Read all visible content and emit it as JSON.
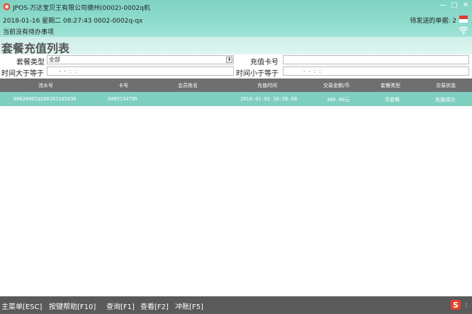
{
  "window": {
    "title": "JPOS-万达宝贝王有限公司德州(0002)-0002q机",
    "controls": [
      "—",
      "□",
      "✕"
    ]
  },
  "status": {
    "info": "2018-01-16 星期二 08:27:43 0002-0002q-qx",
    "pending_label": "待发送的单据: 2",
    "notice": "当前没有待办事项"
  },
  "page": {
    "title": "套餐充值列表"
  },
  "filters": {
    "package_type_label": "套餐类型",
    "package_type_value": "全部",
    "card_no_label": "充值卡号",
    "card_no_value": "",
    "time_from_label": "时间大于等于",
    "time_from_value": "- -    : :",
    "time_to_label": "时间小于等于",
    "time_to_value": "- -    : :"
  },
  "table": {
    "columns": [
      "流水号",
      "卡号",
      "会员姓名",
      "充值时间",
      "交易金额/币",
      "套餐类型",
      "交易状态"
    ],
    "rows": [
      {
        "serial": "00020002q180102165636",
        "card": "A005154795",
        "member": "",
        "time": "2018-01-02 16:56:08",
        "amount": "300.00元",
        "type": "币套餐",
        "state": "充值成功"
      }
    ]
  },
  "shortcuts": [
    "主菜单[ESC]",
    "按键帮助[F10]",
    "查询[F1]",
    "查看[F2]",
    "冲账[F5]"
  ],
  "colors": {
    "titlebar": "#7fd3c3",
    "header_row": "#6f6f6f",
    "selected_row": "#7ecfc0",
    "bottombar": "#5a5a5a"
  }
}
